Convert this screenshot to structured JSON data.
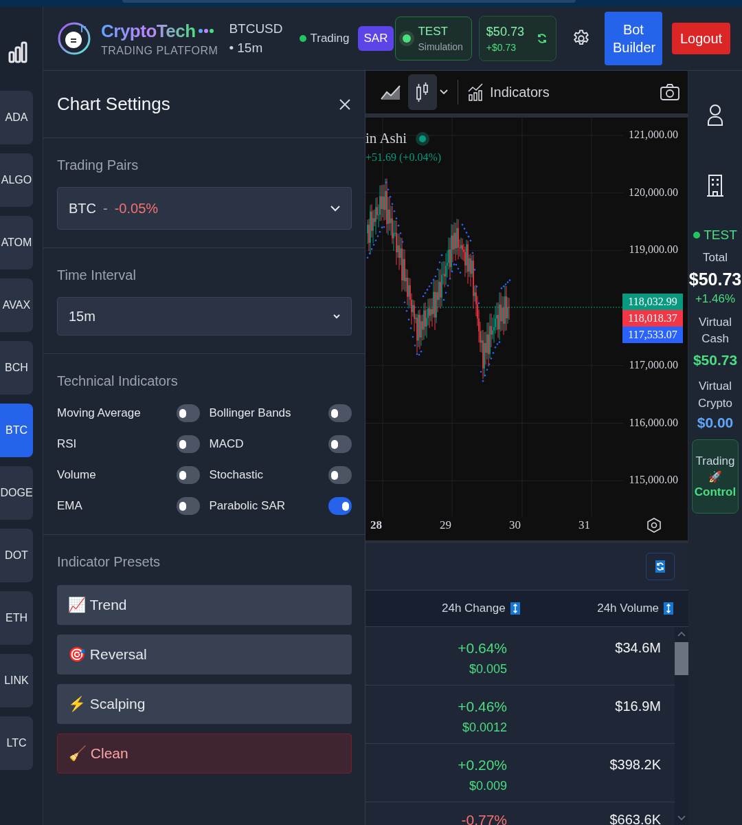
{
  "header": {
    "brand": "CryptoTech",
    "tagline": "TRADING PLATFORM",
    "symbol": "BTCUSD",
    "interval": "• 15m",
    "status": "Trading",
    "indicator_badge": "SAR",
    "mode": {
      "label": "TEST",
      "sub": "Simulation"
    },
    "balance": {
      "value": "$50.73",
      "change": "+$0.73"
    },
    "buttons": [
      {
        "label": "Bot Builder",
        "kind": "primary"
      },
      {
        "label": "Logout",
        "kind": "danger"
      }
    ]
  },
  "coins": [
    {
      "label": "ADA",
      "selected": false
    },
    {
      "label": "ALGO",
      "selected": false
    },
    {
      "label": "ATOM",
      "selected": false
    },
    {
      "label": "AVAX",
      "selected": false
    },
    {
      "label": "BCH",
      "selected": false
    },
    {
      "label": "BTC",
      "selected": true
    },
    {
      "label": "DOGE",
      "selected": false
    },
    {
      "label": "DOT",
      "selected": false
    },
    {
      "label": "ETH",
      "selected": false
    },
    {
      "label": "LINK",
      "selected": false
    },
    {
      "label": "LTC",
      "selected": false
    }
  ],
  "settings": {
    "title": "Chart Settings",
    "trading_pairs": {
      "label": "Trading Pairs",
      "pair": "BTC",
      "separator": "-",
      "change": "-0.05%"
    },
    "time_interval": {
      "label": "Time Interval",
      "value": "15m"
    },
    "indicators": {
      "label": "Technical Indicators",
      "items": [
        {
          "name": "Moving Average",
          "on": false
        },
        {
          "name": "Bollinger Bands",
          "on": false
        },
        {
          "name": "RSI",
          "on": false
        },
        {
          "name": "MACD",
          "on": false
        },
        {
          "name": "Volume",
          "on": false
        },
        {
          "name": "Stochastic",
          "on": false
        },
        {
          "name": "EMA",
          "on": false
        },
        {
          "name": "Parabolic SAR",
          "on": true
        }
      ]
    },
    "presets": {
      "label": "Indicator Presets",
      "items": [
        {
          "label": "📈 Trend",
          "kind": "normal"
        },
        {
          "label": "🎯 Reversal",
          "kind": "normal"
        },
        {
          "label": "⚡ Scalping",
          "kind": "normal"
        },
        {
          "label": "🧹 Clean",
          "kind": "danger"
        }
      ]
    }
  },
  "chart": {
    "styles": [
      {
        "kind": "area",
        "selected": false
      },
      {
        "kind": "candles",
        "selected": true
      }
    ],
    "indicators_label": "Indicators",
    "legend": {
      "title": "in Ashi",
      "change": "+51.69 (+0.04%)"
    },
    "price_ticks": [
      "121,000.00",
      "120,000.00",
      "119,000.00",
      "117,000.00",
      "116,000.00",
      "115,000.00"
    ],
    "x_ticks": [
      "28",
      "29",
      "30",
      "31"
    ],
    "price_tags": [
      {
        "value": "118,032.99",
        "color": "#089981"
      },
      {
        "value": "118,018.37",
        "color": "#f23645"
      },
      {
        "value": "117,533.07",
        "color": "#2962ff"
      }
    ]
  },
  "market_table": {
    "columns": [
      {
        "label": "24h Change"
      },
      {
        "label": "24h Volume"
      }
    ],
    "rows": [
      {
        "change": "+0.64%",
        "change_value": "$0.005",
        "color": "#4ade80",
        "volume": "$34.6M"
      },
      {
        "change": "+0.46%",
        "change_value": "$0.0012",
        "color": "#4ade80",
        "volume": "$16.9M"
      },
      {
        "change": "+0.20%",
        "change_value": "$0.009",
        "color": "#4ade80",
        "volume": "$398.2K"
      },
      {
        "change": "-0.77%",
        "color": "#f87171",
        "volume": "$663.6K"
      }
    ]
  },
  "account": {
    "mode": "TEST",
    "total_label": "Total",
    "total": "$50.73",
    "total_change": "+1.46%",
    "cash_label": "Virtual Cash",
    "cash": "$50.73",
    "crypto_label": "Virtual Crypto",
    "crypto": "$0.00",
    "control": {
      "top": "Trading",
      "icon": "🚀",
      "bottom": "Control"
    }
  }
}
